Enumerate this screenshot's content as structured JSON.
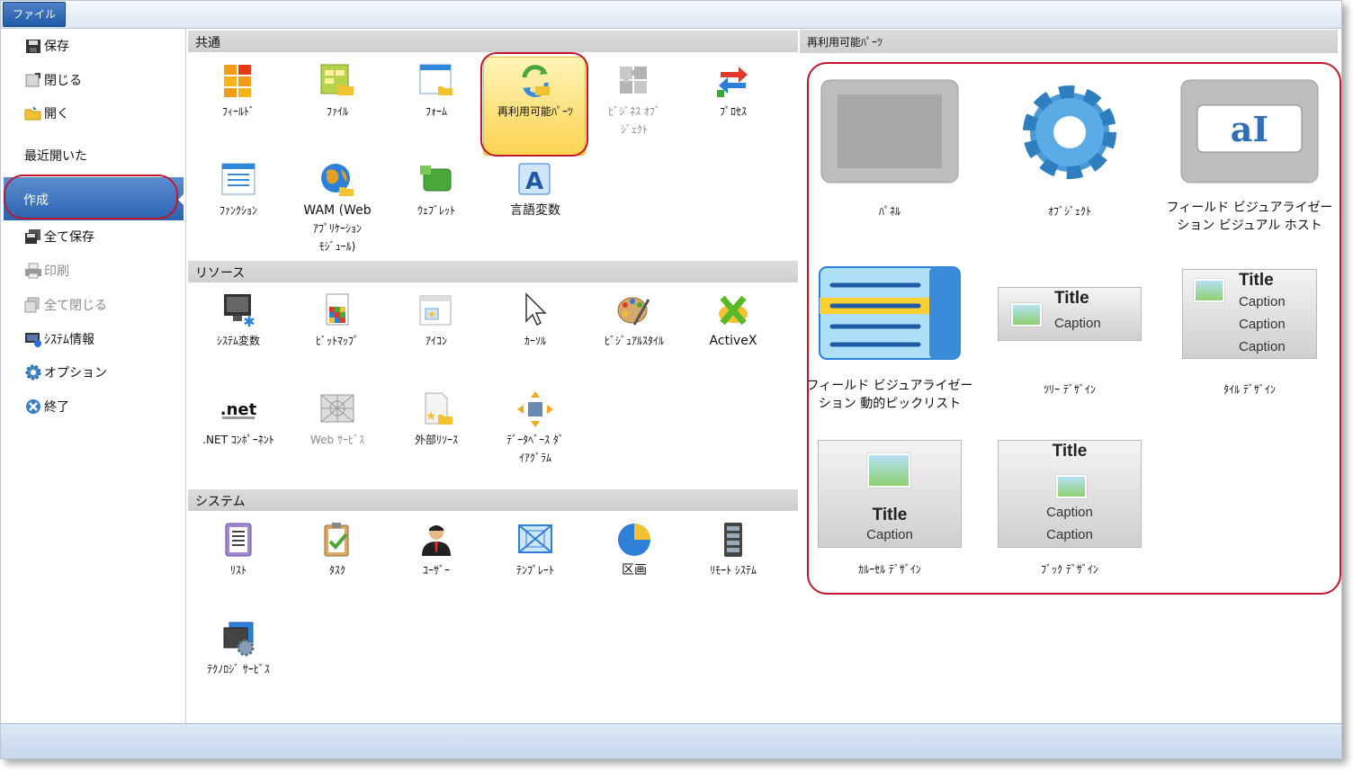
{
  "file_tab": "ファイル",
  "sidebar": {
    "save": "保存",
    "close": "閉じる",
    "open": "開く",
    "recent": "最近開いた",
    "create": "作成",
    "save_all": "全て保存",
    "print": "印刷",
    "close_all": "全て閉じる",
    "system_info": "ｼｽﾃﾑ情報",
    "options": "オプション",
    "exit": "終了"
  },
  "sections": {
    "common": "共通",
    "resources": "リソース",
    "system": "システム",
    "reusable_parts": "再利用可能ﾊﾟｰﾂ"
  },
  "common_items": {
    "field": "ﾌｨｰﾙﾄﾞ",
    "file": "ﾌｧｲﾙ",
    "form": "ﾌｫｰﾑ",
    "reusable": "再利用可能ﾊﾟｰﾂ",
    "business_object_1": "ﾋﾞｼﾞﾈｽ ｵﾌﾞ",
    "business_object_2": "ｼﾞｪｸﾄ",
    "process": "ﾌﾟﾛｾｽ",
    "function": "ﾌｧﾝｸｼｮﾝ",
    "wam_1": "WAM (Web",
    "wam_2": "ｱﾌﾟﾘｹｰｼｮﾝ",
    "wam_3": "ﾓｼﾞｭｰﾙ)",
    "weblet": "ｳｪﾌﾞﾚｯﾄ",
    "language_variable": "言語変数"
  },
  "resource_items": {
    "system_variable": "ｼｽﾃﾑ変数",
    "bitmap": "ﾋﾞｯﾄﾏｯﾌﾟ",
    "icon": "ｱｲｺﾝ",
    "cursor": "ｶｰｿﾙ",
    "visual_style": "ﾋﾞｼﾞｭｱﾙｽﾀｲﾙ",
    "activex": "ActiveX",
    "net_component": ".NET ｺﾝﾎﾟｰﾈﾝﾄ",
    "web_service": "Web ｻｰﾋﾞｽ",
    "external_resource": "外部ﾘｿｰｽ",
    "db_diagram_1": "ﾃﾞｰﾀﾍﾞｰｽ ﾀﾞ",
    "db_diagram_2": "ｲｱｸﾞﾗﾑ"
  },
  "system_items": {
    "list": "ﾘｽﾄ",
    "task": "ﾀｽｸ",
    "user": "ﾕｰｻﾞｰ",
    "template": "ﾃﾝﾌﾟﾚｰﾄ",
    "partition": "区画",
    "remote_system": "ﾘﾓｰﾄ ｼｽﾃﾑ",
    "technology_service": "ﾃｸﾉﾛｼﾞ ｻｰﾋﾞｽ"
  },
  "reusable_items": {
    "panel": "ﾊﾟﾈﾙ",
    "object": "ｵﾌﾞｼﾞｪｸﾄ",
    "fv_host_1": "フィールド ビジュアライゼー",
    "fv_host_2": "ション ビジュアル ホスト",
    "fv_picklist_1": "フィールド ビジュアライゼー",
    "fv_picklist_2": "ション 動的ピックリスト",
    "tree_design": "ﾂﾘｰ ﾃﾞｻﾞｲﾝ",
    "tile_design": "ﾀｲﾙ ﾃﾞｻﾞｲﾝ",
    "carousel_design": "ｶﾙｰｾﾙ ﾃﾞｻﾞｲﾝ",
    "book_design": "ﾌﾞｯｸ ﾃﾞｻﾞｲﾝ"
  },
  "previews": {
    "title": "Title",
    "caption": "Caption",
    "ai_glyph": "aI"
  },
  "colors": {
    "highlight_ring": "#c0172c",
    "active_nav": "#2a63b0",
    "selected_tile": "#fbd350"
  }
}
